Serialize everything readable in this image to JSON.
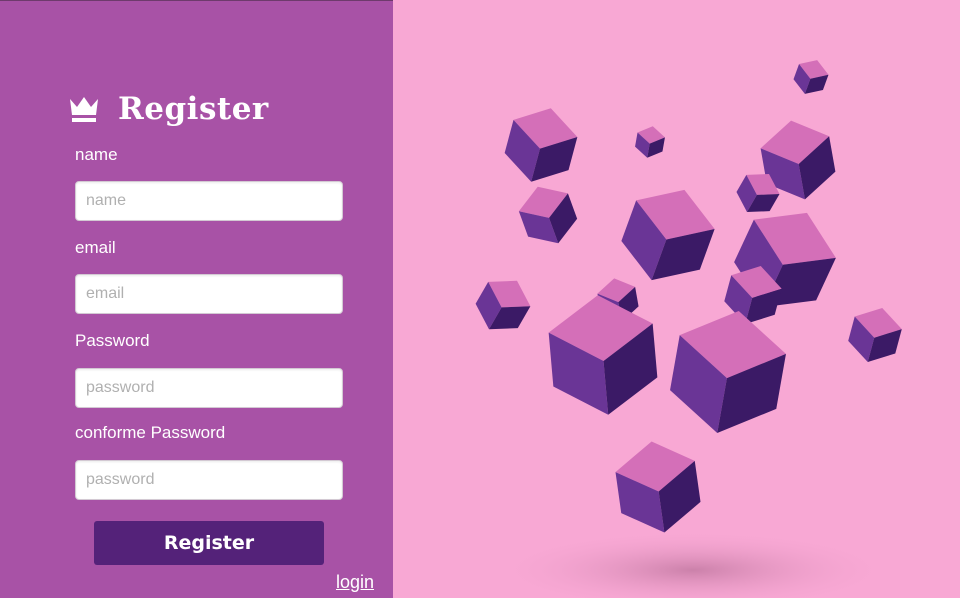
{
  "brand": {
    "title": "Register",
    "icon": "crown-icon"
  },
  "form": {
    "fields": [
      {
        "label": "name",
        "placeholder": "name"
      },
      {
        "label": "email",
        "placeholder": "email"
      },
      {
        "label": "Password",
        "placeholder": "password"
      },
      {
        "label": "conforme Password",
        "placeholder": "password"
      }
    ],
    "submit_label": "Register",
    "login_link": "login"
  },
  "colors": {
    "panel": "#a852a6",
    "background": "#f8a8d4",
    "button": "#542279",
    "cube_dark": "#3b1a66",
    "cube_mid": "#6a3596",
    "cube_light": "#d46fb8"
  }
}
